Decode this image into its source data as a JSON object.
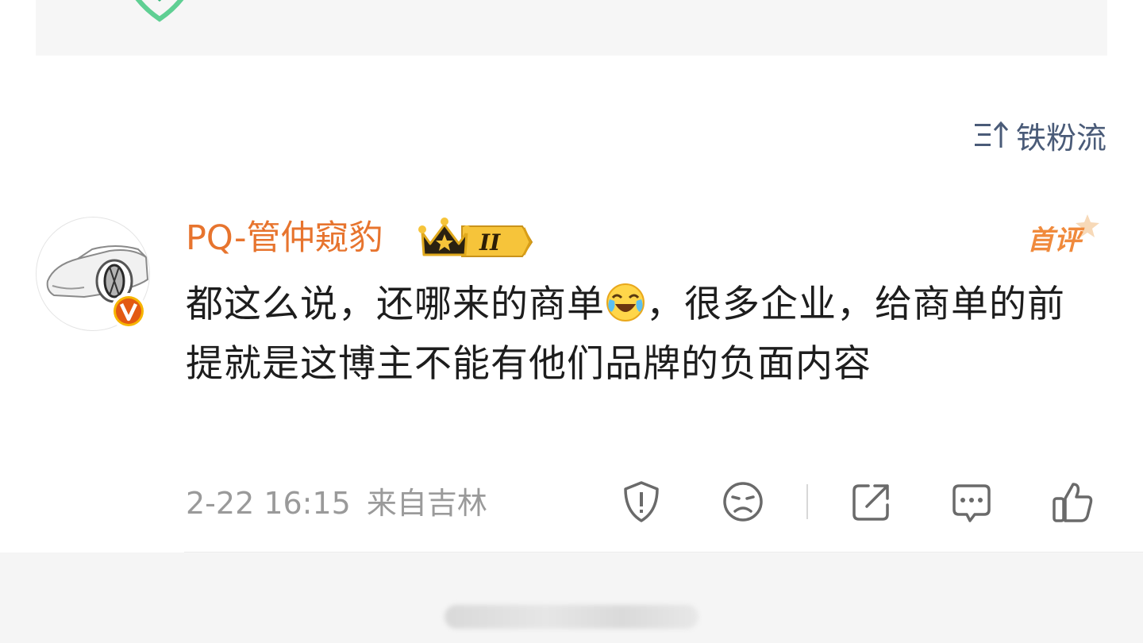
{
  "sort": {
    "label": "铁粉流",
    "icon": "sort-icon"
  },
  "comment": {
    "username": "PQ-管仲窥豹",
    "badge_level": "II",
    "first_comment_label": "首评",
    "text_part1": "都这么说，还哪来的商单",
    "emoji": "laughing-crying-emoji",
    "text_part2": "，很多企业，给商单的前提就是这博主不能有他们品牌的负面内容",
    "date": "2-22 16:15",
    "location": "来自吉林",
    "actions": [
      "report-icon",
      "dislike-icon",
      "share-icon",
      "reply-icon",
      "like-icon"
    ]
  },
  "colors": {
    "username": "#e7742e",
    "text": "#1d1d1d",
    "meta": "#9a9a9a",
    "sort": "#4a5b78",
    "verified_badge": "#e35a12",
    "crown_gold": "#f2b21c"
  }
}
